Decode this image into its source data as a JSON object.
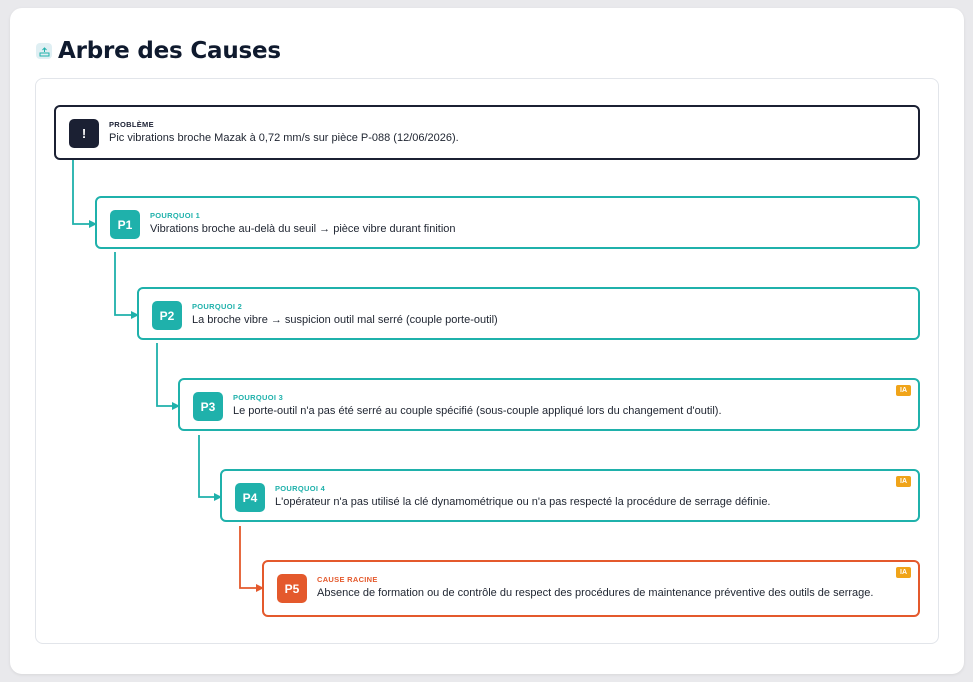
{
  "header": {
    "title": "Arbre des Causes",
    "icon": "tree-icon"
  },
  "problem": {
    "badge": "!",
    "label": "PROBLÈME",
    "text": "Pic vibrations broche Mazak à 0,72 mm/s sur pièce P-088 (12/06/2026)."
  },
  "whys": [
    {
      "badge": "P1",
      "label": "POURQUOI 1",
      "text": "Vibrations broche au-delà du seuil → pièce vibre durant finition",
      "ia": ""
    },
    {
      "badge": "P2",
      "label": "POURQUOI 2",
      "text": "La broche vibre → suspicion outil mal serré (couple porte-outil)",
      "ia": ""
    },
    {
      "badge": "P3",
      "label": "POURQUOI 3",
      "text": "Le porte-outil n'a pas été serré au couple spécifié (sous-couple appliqué lors du changement d'outil).",
      "ia": "IA"
    },
    {
      "badge": "P4",
      "label": "POURQUOI 4",
      "text": "L'opérateur n'a pas utilisé la clé dynamométrique ou n'a pas respecté la procédure de serrage définie.",
      "ia": "IA"
    }
  ],
  "root_cause": {
    "badge": "P5",
    "label": "CAUSE RACINE",
    "text": "Absence de formation ou de contrôle du respect des procédures de maintenance préventive des outils de serrage.",
    "ia": "IA"
  },
  "colors": {
    "teal": "#1fb1ab",
    "navy": "#1b2033",
    "orange": "#e4592c",
    "ia": "#f0a419"
  }
}
